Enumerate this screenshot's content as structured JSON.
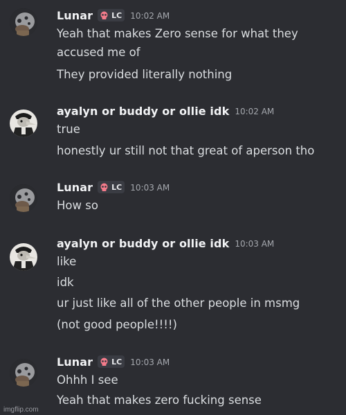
{
  "messages": [
    {
      "author": "Lunar",
      "role_tag": "LC",
      "timestamp": "10:02 AM",
      "avatar_icon": "gray-cartoon-character-avatar",
      "lines": [
        "Yeah that makes Zero sense for what they",
        "accused me of",
        "They provided literally nothing"
      ]
    },
    {
      "author": "ayalyn or buddy or ollie idk",
      "timestamp": "10:02 AM",
      "avatar_icon": "plague-doctor-avatar",
      "lines": [
        "true",
        "honestly ur still not that great of aperson tho"
      ]
    },
    {
      "author": "Lunar",
      "role_tag": "LC",
      "timestamp": "10:03 AM",
      "avatar_icon": "gray-cartoon-character-avatar",
      "lines": [
        "How so"
      ]
    },
    {
      "author": "ayalyn or buddy or ollie idk",
      "timestamp": "10:03 AM",
      "avatar_icon": "plague-doctor-avatar",
      "lines": [
        "like",
        "idk",
        "ur just like all of the other people in msmg",
        "(not good people!!!!)"
      ]
    },
    {
      "author": "Lunar",
      "role_tag": "LC",
      "timestamp": "10:03 AM",
      "avatar_icon": "gray-cartoon-character-avatar",
      "lines": [
        "Ohhh I see",
        "Yeah that makes zero fucking sense"
      ]
    }
  ],
  "role_icon": "pink-skull-icon",
  "watermark": "imgflip.com",
  "colors": {
    "background": "#2c2d32",
    "username": "#f2f3f5",
    "message_text": "#dbdee1",
    "timestamp": "#a5a8ae",
    "role_tag_bg": "#3a3c43",
    "skull": "#f47b8a"
  }
}
